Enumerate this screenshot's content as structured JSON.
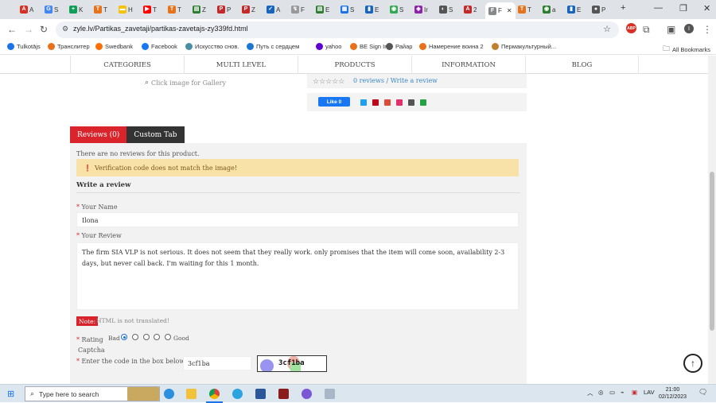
{
  "browser": {
    "tabs": [
      {
        "title": "A",
        "color": "#d93025",
        "letter": "A"
      },
      {
        "title": "S",
        "color": "#4285f4",
        "letter": "G"
      },
      {
        "title": "K",
        "color": "#0f9d58",
        "letter": "+"
      },
      {
        "title": "T",
        "color": "#e8711a",
        "letter": "T"
      },
      {
        "title": "H",
        "color": "#f4c20d",
        "letter": "▬"
      },
      {
        "title": "T",
        "color": "#ff0000",
        "letter": "▶"
      },
      {
        "title": "T",
        "color": "#e8711a",
        "letter": "T"
      },
      {
        "title": "Z",
        "color": "#2e7d32",
        "letter": "▤"
      },
      {
        "title": "P",
        "color": "#c62828",
        "letter": "P"
      },
      {
        "title": "Z",
        "color": "#c62828",
        "letter": "P"
      },
      {
        "title": "A",
        "color": "#1565c0",
        "letter": "✓"
      },
      {
        "title": "F",
        "color": "#999999",
        "letter": "↯"
      },
      {
        "title": "E",
        "color": "#2e7d32",
        "letter": "▤"
      },
      {
        "title": "S",
        "color": "#1a73e8",
        "letter": "▦"
      },
      {
        "title": "E",
        "color": "#1565c0",
        "letter": "▮"
      },
      {
        "title": "S",
        "color": "#34a853",
        "letter": "◉"
      },
      {
        "title": "Ir",
        "color": "#8e24aa",
        "letter": "◈"
      },
      {
        "title": "S",
        "color": "#555555",
        "letter": "◐"
      },
      {
        "title": "2",
        "color": "#c62828",
        "letter": "A"
      }
    ],
    "active_tab": {
      "title": "F",
      "letter": "F"
    },
    "tabs_after": [
      {
        "title": "T",
        "color": "#e8711a",
        "letter": "T"
      },
      {
        "title": "a",
        "color": "#2e7d32",
        "letter": "◉"
      },
      {
        "title": "E",
        "color": "#1565c0",
        "letter": "▮"
      },
      {
        "title": "P",
        "color": "#555555",
        "letter": "●"
      }
    ],
    "url": "zyle.lv/Partikas_zavetaji/partikas-zavetajs-zy339fd.html",
    "bookmarks": [
      {
        "label": "Tulkotājs",
        "color": "#1a73e8"
      },
      {
        "label": "Транслитер",
        "color": "#e8711a"
      },
      {
        "label": "Swedbank",
        "color": "#ff6f00"
      },
      {
        "label": "Facebook",
        "color": "#1877f2"
      },
      {
        "label": "Искусство снов.",
        "color": "#4a90a4"
      },
      {
        "label": "Путь с сердцем",
        "color": "#1976d2"
      },
      {
        "label": "yahoo",
        "color": "#6001d2"
      },
      {
        "label": "BE Sign In",
        "color": "#e8711a"
      },
      {
        "label": "Райар",
        "color": "#555555"
      },
      {
        "label": "Намерение воина 2",
        "color": "#e8711a"
      },
      {
        "label": "Пермакультурный...",
        "color": "#c08030"
      }
    ],
    "all_bookmarks": "All Bookmarks"
  },
  "site": {
    "nav": [
      "CATEGORIES",
      "MULTI LEVEL",
      "PRODUCTS",
      "INFORMATION",
      "BLOG"
    ],
    "gallery_link": "Click image for Gallery",
    "reviews_link": "0 reviews",
    "write_review_link": "Write a review",
    "fb_like": "Like 0",
    "share_colors": [
      "#1da1f2",
      "#bd081c",
      "#dd4b39",
      "#e1306c",
      "#555555",
      "#25a244"
    ]
  },
  "tabs": {
    "reviews": "Reviews (0)",
    "custom": "Custom Tab",
    "active_color": "#d9242c",
    "inactive_color": "#333333"
  },
  "review_form": {
    "no_reviews": "There are no reviews for this product.",
    "alert": "Verification code does not match the image!",
    "title": "Write a review",
    "name_label": "Your Name",
    "name_value": "Ilona",
    "review_label": "Your Review",
    "review_value": "The firm SIA VLP is not serious. It does not seem that they really work. only promises that the item will come soon,  availability 2-3 days, but never call back. I'm waiting for this 1 month.",
    "note_badge": "Note:",
    "note_text": "HTML is not translated!",
    "rating_label": "Rating",
    "bad": "Bad",
    "good": "Good",
    "selected_rating": 1,
    "captcha_title": "Captcha",
    "captcha_prompt": "Enter the code in the box below",
    "captcha_value": "3cf1ba",
    "captcha_image_text": "3cf1ba"
  },
  "taskbar": {
    "search_placeholder": "Type here to search",
    "language": "LAV",
    "time": "21:00",
    "date": "02/12/2023"
  }
}
